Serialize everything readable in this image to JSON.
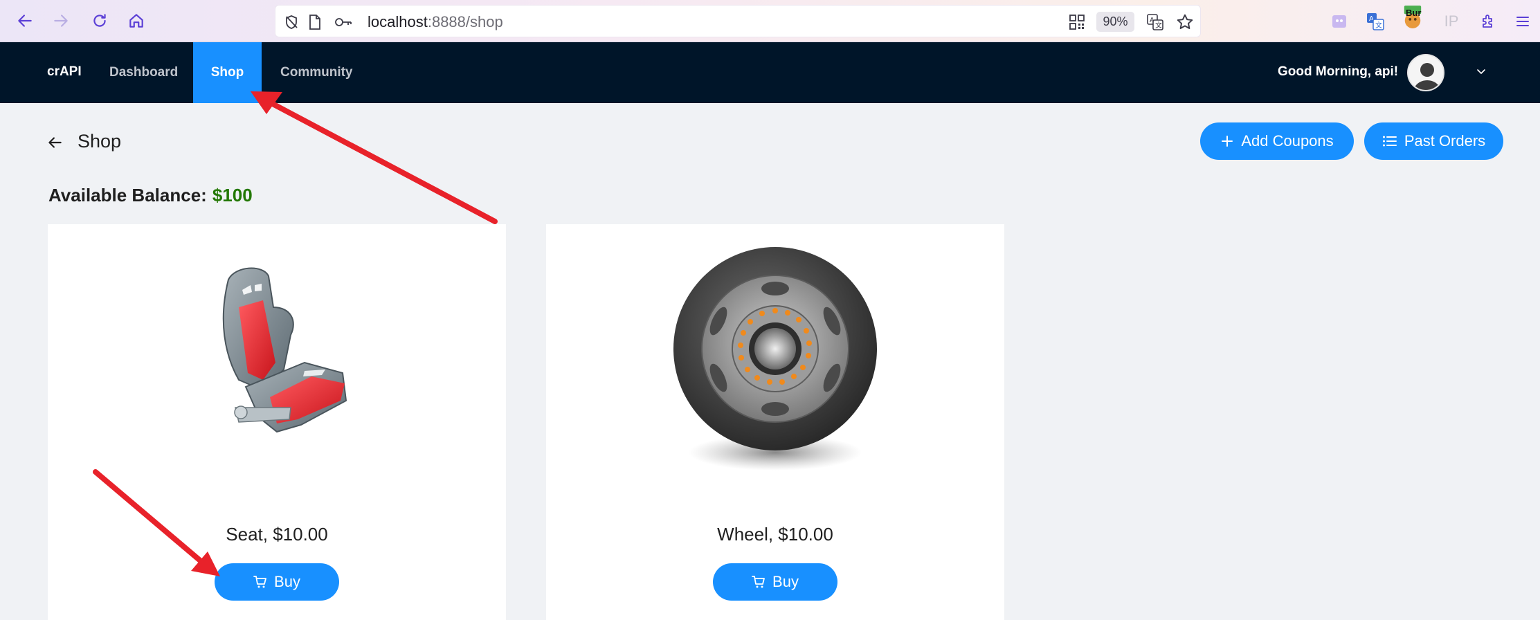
{
  "browser": {
    "url_host": "localhost",
    "url_port_path": ":8888/shop",
    "zoom": "90%",
    "extension_badge": "Bur",
    "extension_ip": "IP"
  },
  "nav": {
    "brand": "crAPI",
    "items": [
      {
        "label": "Dashboard"
      },
      {
        "label": "Shop"
      },
      {
        "label": "Community"
      }
    ],
    "greeting": "Good Morning, api!"
  },
  "page": {
    "title": "Shop",
    "add_coupons_label": "Add Coupons",
    "past_orders_label": "Past Orders",
    "balance_label": "Available Balance:",
    "balance_value": "$100"
  },
  "products": [
    {
      "label": "Seat, $10.00",
      "buy_label": "Buy",
      "image": "car-seat"
    },
    {
      "label": "Wheel, $10.00",
      "buy_label": "Buy",
      "image": "wheel"
    }
  ],
  "colors": {
    "primary": "#1890ff",
    "navbar": "#001529",
    "balance": "#237804",
    "annotation": "#e8222a"
  }
}
